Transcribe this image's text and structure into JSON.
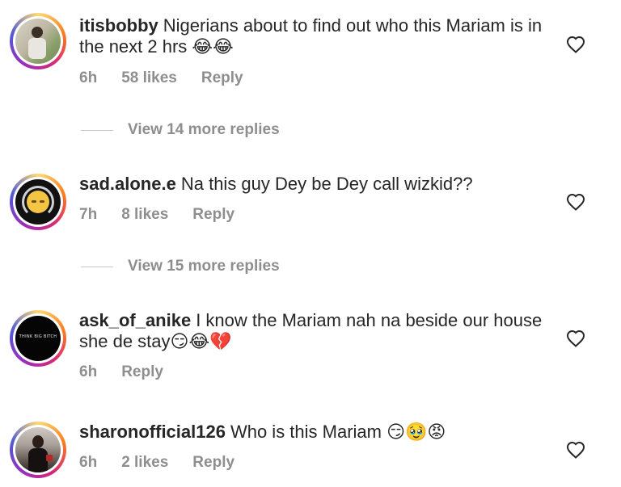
{
  "comments": [
    {
      "username": "itisbobby",
      "text": "Nigerians about to find out who this Mariam is in the next 2 hrs 😂😂",
      "time": "6h",
      "likes": "58 likes",
      "reply": "Reply"
    },
    {
      "username": "sad.alone.e",
      "text": "Na this guy Dey be Dey call wizkid??",
      "time": "7h",
      "likes": "8 likes",
      "reply": "Reply"
    },
    {
      "username": "ask_of_anike",
      "text": "I know the Mariam nah na beside our house she de stay😏😂💔",
      "time": "6h",
      "likes": "",
      "reply": "Reply",
      "avatar_text": "THINK BIG BITCH"
    },
    {
      "username": "sharonofficial126",
      "text": "Who is this Mariam 😏🥹😡",
      "time": "6h",
      "likes": "2 likes",
      "reply": "Reply"
    }
  ],
  "view_more": [
    "View 14 more replies",
    "View 15 more replies"
  ],
  "colors": {
    "text": "#262626",
    "meta": "#8e8e8e",
    "ring_gradient": [
      "#feda75",
      "#fa7e1e",
      "#d62976",
      "#962fbf",
      "#4f5bd5"
    ]
  },
  "icons": {
    "like": "heart-icon"
  }
}
